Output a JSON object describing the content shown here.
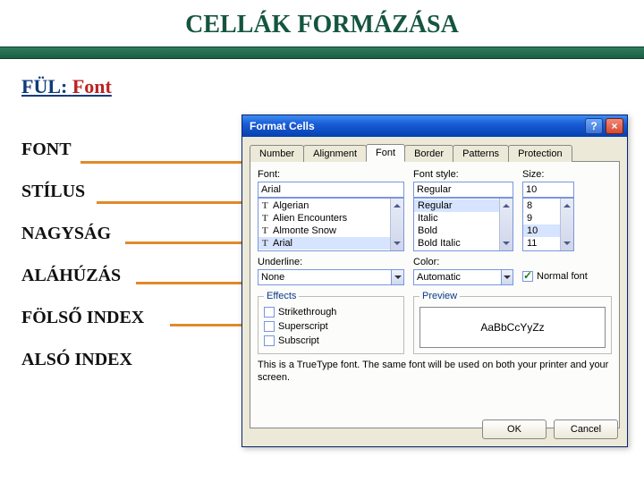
{
  "slide": {
    "title": "CELLÁK FORMÁZÁSA",
    "tab_prefix": "FÜL:",
    "tab_word": "Font"
  },
  "labels": {
    "font": "FONT",
    "style": "STÍLUS",
    "size": "NAGYSÁG",
    "underline": "ALÁHÚZÁS",
    "superscript": "FÖLSŐ INDEX",
    "subscript": "ALSÓ INDEX"
  },
  "dialog": {
    "title": "Format Cells",
    "help": "?",
    "close": "×",
    "tabs": [
      "Number",
      "Alignment",
      "Font",
      "Border",
      "Patterns",
      "Protection"
    ],
    "font": {
      "label": "Font:",
      "value": "Arial",
      "items": [
        "Algerian",
        "Alien Encounters",
        "Almonte Snow",
        "Arial"
      ]
    },
    "style": {
      "label": "Font style:",
      "value": "Regular",
      "items": [
        "Regular",
        "Italic",
        "Bold",
        "Bold Italic"
      ]
    },
    "size": {
      "label": "Size:",
      "value": "10",
      "items": [
        "8",
        "9",
        "10",
        "11"
      ]
    },
    "underline": {
      "label": "Underline:",
      "value": "None"
    },
    "color": {
      "label": "Color:",
      "value": "Automatic"
    },
    "normal_font": "Normal font",
    "effects": {
      "title": "Effects",
      "strike": "Strikethrough",
      "super": "Superscript",
      "sub": "Subscript"
    },
    "preview": {
      "title": "Preview",
      "sample": "AaBbCcYyZz"
    },
    "hint": "This is a TrueType font.  The same font will be used on both your printer and your screen.",
    "ok": "OK",
    "cancel": "Cancel"
  }
}
